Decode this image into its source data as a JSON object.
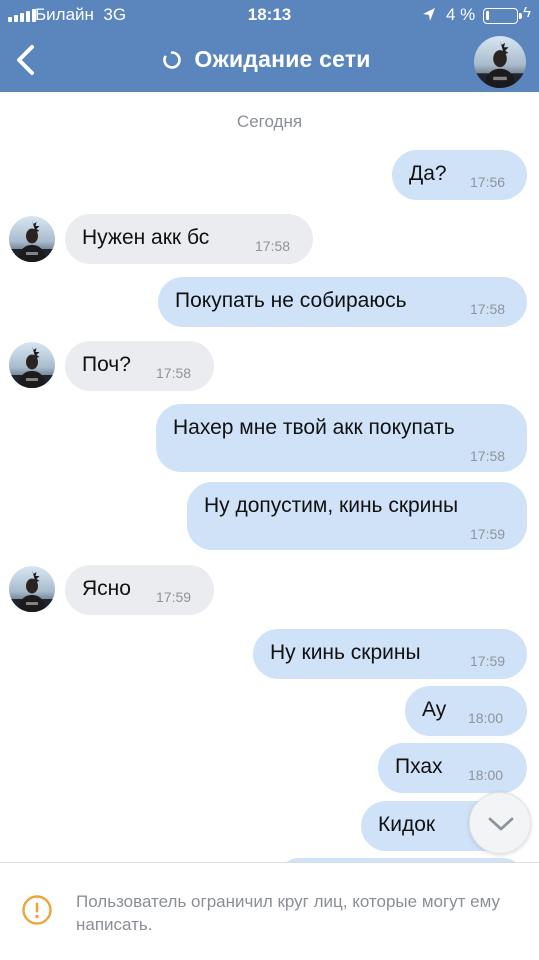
{
  "status_bar": {
    "carrier": "Билайн",
    "network": "3G",
    "time": "18:13",
    "battery_percent": "4 %",
    "battery_level": 0.04,
    "icons": [
      "signal-bars-icon",
      "location-arrow-icon",
      "battery-icon",
      "charging-bolt-icon"
    ]
  },
  "header": {
    "title": "Ожидание сети",
    "back_icon": "chevron-left-icon",
    "spinner_icon": "loading-spinner-icon",
    "color": "#5b85bd"
  },
  "chat": {
    "date_separator": "Сегодня",
    "messages": [
      {
        "direction": "outgoing",
        "text": "Да?",
        "time": "17:56"
      },
      {
        "direction": "incoming",
        "text": "Нужен акк бс",
        "time": "17:58"
      },
      {
        "direction": "outgoing",
        "text": "Покупать не собираюсь",
        "time": "17:58"
      },
      {
        "direction": "incoming",
        "text": "Поч?",
        "time": "17:58"
      },
      {
        "direction": "outgoing",
        "text": "Нахер мне твой акк покупать",
        "time": "17:58"
      },
      {
        "direction": "outgoing",
        "text": "Ну допустим, кинь скрины",
        "time": "17:59"
      },
      {
        "direction": "incoming",
        "text": "Ясно",
        "time": "17:59"
      },
      {
        "direction": "outgoing",
        "text": "Ну кинь скрины",
        "time": "17:59"
      },
      {
        "direction": "outgoing",
        "text": "Ау",
        "time": "18:00"
      },
      {
        "direction": "outgoing",
        "text": "Пхах",
        "time": "18:00"
      },
      {
        "direction": "outgoing",
        "text": "Кидок",
        "time": ""
      }
    ],
    "colors": {
      "outgoing_bubble": "#cfe2f8",
      "incoming_bubble": "#ebecef"
    },
    "scroll_down_icon": "chevron-down-icon"
  },
  "footer": {
    "notice": "Пользователь ограничил круг лиц, которые могут ему написать.",
    "icon": "warning-circle-icon",
    "icon_color": "#f0a33a"
  }
}
